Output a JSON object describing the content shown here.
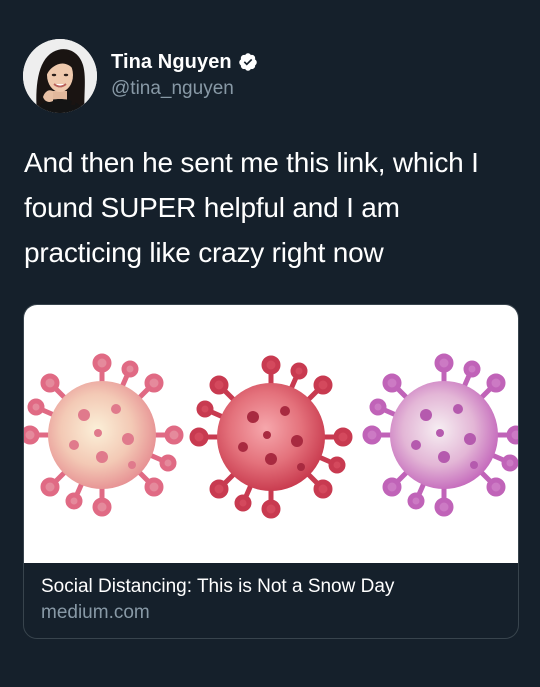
{
  "user": {
    "display_name": "Tina Nguyen",
    "handle": "@tina_nguyen",
    "verified_icon": "verified-badge-icon",
    "avatar_icon": "profile-photo"
  },
  "tweet": {
    "line1": "And then he sent me this link, which I",
    "line2": "found SUPER helpful and I am",
    "line3": "practicing like crazy right now"
  },
  "link_card": {
    "image_icon": "virus-illustration",
    "title": "Social Distancing: This is Not a Snow Day",
    "domain": "medium.com"
  },
  "colors": {
    "background": "#15202b",
    "text_primary": "#ffffff",
    "text_secondary": "#8899a6",
    "card_border": "#38444d",
    "verified_badge": "#ffffff"
  }
}
